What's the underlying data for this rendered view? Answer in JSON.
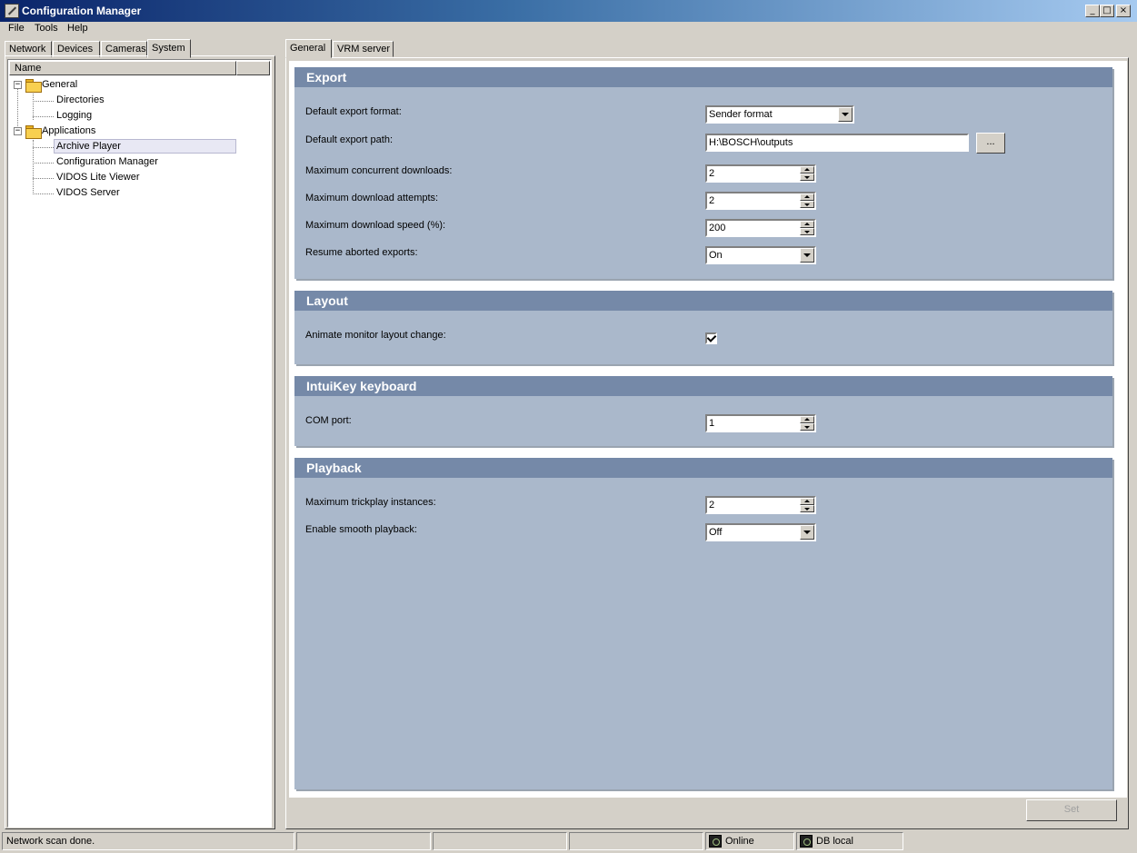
{
  "window": {
    "title": "Configuration Manager",
    "controls": {
      "minimize": "_",
      "maximize": "□",
      "close": "×"
    }
  },
  "menu": [
    "File",
    "Tools",
    "Help"
  ],
  "left_tabs": [
    "Network",
    "Devices",
    "Cameras",
    "System"
  ],
  "left_active_tab": "System",
  "tree": {
    "column_header": "Name",
    "nodes": [
      {
        "label": "General",
        "expander": "−",
        "icon": "folder-icon"
      },
      {
        "label": "Directories"
      },
      {
        "label": "Logging"
      },
      {
        "label": "Applications",
        "expander": "−",
        "icon": "folder-icon"
      },
      {
        "label": "Archive Player",
        "selected": true
      },
      {
        "label": "Configuration Manager"
      },
      {
        "label": "VIDOS Lite Viewer"
      },
      {
        "label": "VIDOS Server"
      }
    ]
  },
  "right_tabs": [
    "General",
    "VRM server"
  ],
  "right_active_tab": "General",
  "sections": {
    "export": {
      "title": "Export",
      "rows": [
        {
          "label": "Default export format:",
          "value": "Sender format"
        },
        {
          "label": "Default export path:",
          "value": "H:\\BOSCH\\outputs",
          "browse": "..."
        },
        {
          "label": "Maximum concurrent downloads:",
          "value": "2"
        },
        {
          "label": "Maximum download attempts:",
          "value": "2"
        },
        {
          "label": "Maximum download speed (%):",
          "value": "200"
        },
        {
          "label": "Resume aborted exports:",
          "value": "On"
        }
      ]
    },
    "layout": {
      "title": "Layout",
      "rows": [
        {
          "label": "Animate monitor layout change:",
          "checked": true
        }
      ]
    },
    "intuikey": {
      "title": "IntuiKey keyboard",
      "rows": [
        {
          "label": "COM port:",
          "value": "1"
        }
      ]
    },
    "playback": {
      "title": "Playback",
      "rows": [
        {
          "label": "Maximum trickplay instances:",
          "value": "2"
        },
        {
          "label": "Enable smooth playback:",
          "value": "Off"
        }
      ]
    }
  },
  "set_button": "Set",
  "status": {
    "message": "Network scan done.",
    "online": "Online",
    "db": "DB local"
  },
  "colors": {
    "section_header": "#7589a8",
    "section_body": "#aab8cb",
    "title_gradient_start": "#0a246a"
  }
}
